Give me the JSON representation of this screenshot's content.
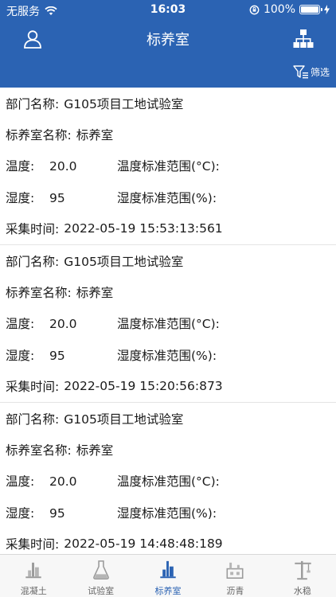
{
  "status_bar": {
    "carrier": "无服务",
    "time": "16:03",
    "battery": "100%"
  },
  "nav": {
    "title": "标养室",
    "filter_label": "筛选"
  },
  "labels": {
    "dept": "部门名称:",
    "room": "标养室名称:",
    "temp": "温度:",
    "temp_range": "温度标准范围(°C):",
    "hum": "湿度:",
    "hum_range": "湿度标准范围(%):",
    "time": "采集时间:"
  },
  "records": [
    {
      "dept": "G105项目工地试验室",
      "room": "标养室",
      "temp": "20.0",
      "hum": "95",
      "time": "2022-05-19 15:53:13:561"
    },
    {
      "dept": "G105项目工地试验室",
      "room": "标养室",
      "temp": "20.0",
      "hum": "95",
      "time": "2022-05-19 15:20:56:873"
    },
    {
      "dept": "G105项目工地试验室",
      "room": "标养室",
      "temp": "20.0",
      "hum": "95",
      "time": "2022-05-19 14:48:48:189"
    }
  ],
  "tabs": [
    {
      "label": "混凝土",
      "icon": "concrete-icon"
    },
    {
      "label": "试验室",
      "icon": "flask-icon"
    },
    {
      "label": "标养室",
      "icon": "curing-room-icon"
    },
    {
      "label": "沥青",
      "icon": "asphalt-plant-icon"
    },
    {
      "label": "水稳",
      "icon": "crane-icon"
    }
  ],
  "colors": {
    "primary": "#2b63b3",
    "tab_active": "#2b63b3",
    "tab_inactive": "#9a9a9a"
  }
}
